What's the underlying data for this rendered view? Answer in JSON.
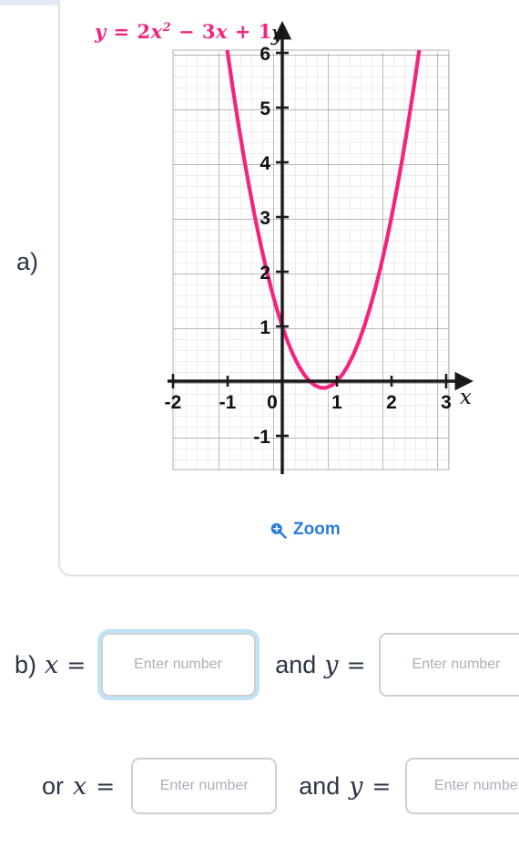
{
  "problem": {
    "part_a_label": "a)",
    "part_b_label": "b)",
    "or_label": "or"
  },
  "graph": {
    "equation_lhs": "y",
    "equation_eq": "=",
    "equation_coef": "2",
    "equation_x": "x",
    "equation_power": "2",
    "equation_minus": "−",
    "equation_bterm": "3",
    "equation_x2": "x",
    "equation_plus": "+",
    "equation_const": "1",
    "equation_text": "y = 2x² − 3x + 1",
    "zoom_label": "Zoom",
    "zoom_icon": "magnifier-plus-icon",
    "curve_color": "#f5237f",
    "axis_color": "#1a1a1a",
    "major_grid_color": "#8d8d8d",
    "minor_grid_color": "#d8d8d8",
    "x_axis_label": "x",
    "y_axis_label": "y"
  },
  "chart_data": {
    "type": "line",
    "title": "y = 2x² − 3x + 1",
    "xlabel": "x",
    "ylabel": "y",
    "xlim": [
      -2.2,
      3.2
    ],
    "ylim": [
      -1.7,
      6.4
    ],
    "xticks": [
      -2,
      -1,
      0,
      1,
      2,
      3
    ],
    "yticks": [
      -1,
      1,
      2,
      3,
      4,
      5,
      6
    ],
    "xtick_labels": [
      "-2",
      "-1",
      "0",
      "1",
      "2",
      "3"
    ],
    "ytick_labels": [
      "-1",
      "1",
      "2",
      "3",
      "4",
      "5",
      "6"
    ],
    "grid": true,
    "minor_grid": true,
    "minor_per_major": 5,
    "legend": false,
    "series": [
      {
        "name": "y = 2x² − 3x + 1",
        "color": "#f5237f",
        "equation": "y = 2*x^2 - 3*x + 1",
        "vertex": [
          0.75,
          -0.125
        ],
        "roots": [
          0.5,
          1.0
        ],
        "y_intercept": 1,
        "points": [
          [
            -1.1,
            6.72
          ],
          [
            -1.0,
            6.0
          ],
          [
            -0.9,
            5.32
          ],
          [
            -0.8,
            4.68
          ],
          [
            -0.7,
            4.08
          ],
          [
            -0.6,
            3.52
          ],
          [
            -0.5,
            3.0
          ],
          [
            -0.4,
            2.52
          ],
          [
            -0.3,
            2.08
          ],
          [
            -0.2,
            1.68
          ],
          [
            -0.1,
            1.32
          ],
          [
            0.0,
            1.0
          ],
          [
            0.1,
            0.72
          ],
          [
            0.2,
            0.48
          ],
          [
            0.3,
            0.28
          ],
          [
            0.4,
            0.12
          ],
          [
            0.5,
            0.0
          ],
          [
            0.6,
            -0.08
          ],
          [
            0.7,
            -0.12
          ],
          [
            0.75,
            -0.125
          ],
          [
            0.8,
            -0.12
          ],
          [
            0.9,
            -0.08
          ],
          [
            1.0,
            0.0
          ],
          [
            1.1,
            0.12
          ],
          [
            1.2,
            0.28
          ],
          [
            1.3,
            0.48
          ],
          [
            1.4,
            0.72
          ],
          [
            1.5,
            1.0
          ],
          [
            1.6,
            1.32
          ],
          [
            1.7,
            1.68
          ],
          [
            1.8,
            2.08
          ],
          [
            1.9,
            2.52
          ],
          [
            2.0,
            3.0
          ],
          [
            2.1,
            3.52
          ],
          [
            2.2,
            4.08
          ],
          [
            2.3,
            4.68
          ],
          [
            2.4,
            5.32
          ],
          [
            2.5,
            6.0
          ],
          [
            2.6,
            6.72
          ]
        ]
      }
    ]
  },
  "answers": {
    "b_x_var": "x",
    "b_y_var": "y",
    "b_eq": "=",
    "and_label": "and",
    "b_x_value": "",
    "b_y_value": "",
    "b_x_placeholder": "Enter number",
    "b_y_placeholder": "Enter number",
    "or_x_var": "x",
    "or_y_var": "y",
    "or_x_value": "",
    "or_y_value": "",
    "or_x_placeholder": "Enter number",
    "or_y_placeholder": "Enter number"
  }
}
